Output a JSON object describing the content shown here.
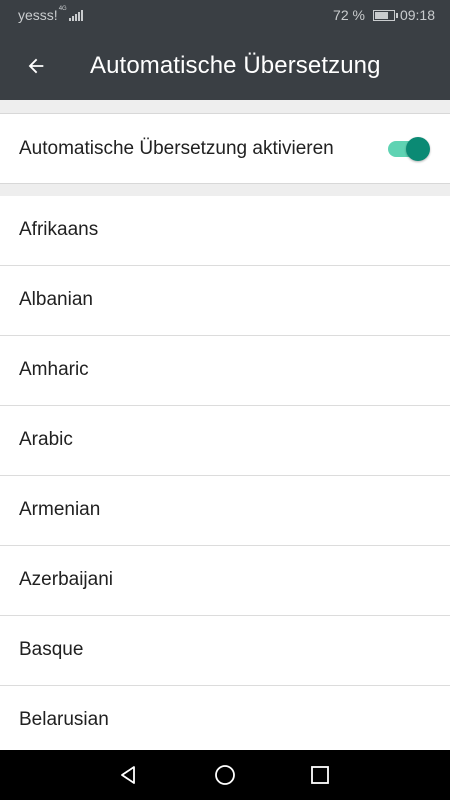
{
  "status_bar": {
    "carrier": "yesss!",
    "network": "4G",
    "battery_percent": "72 %",
    "battery_level": 0.72,
    "time": "09:18"
  },
  "app_bar": {
    "back_icon": "arrow-back-icon",
    "title": "Automatische Übersetzung"
  },
  "toggle": {
    "label": "Automatische Übersetzung aktivieren",
    "enabled": true,
    "accent_color": "#0b8a74"
  },
  "languages": [
    "Afrikaans",
    "Albanian",
    "Amharic",
    "Arabic",
    "Armenian",
    "Azerbaijani",
    "Basque",
    "Belarusian"
  ],
  "nav_bar": {
    "back_icon": "triangle-back-icon",
    "home_icon": "circle-home-icon",
    "recents_icon": "square-recents-icon"
  }
}
